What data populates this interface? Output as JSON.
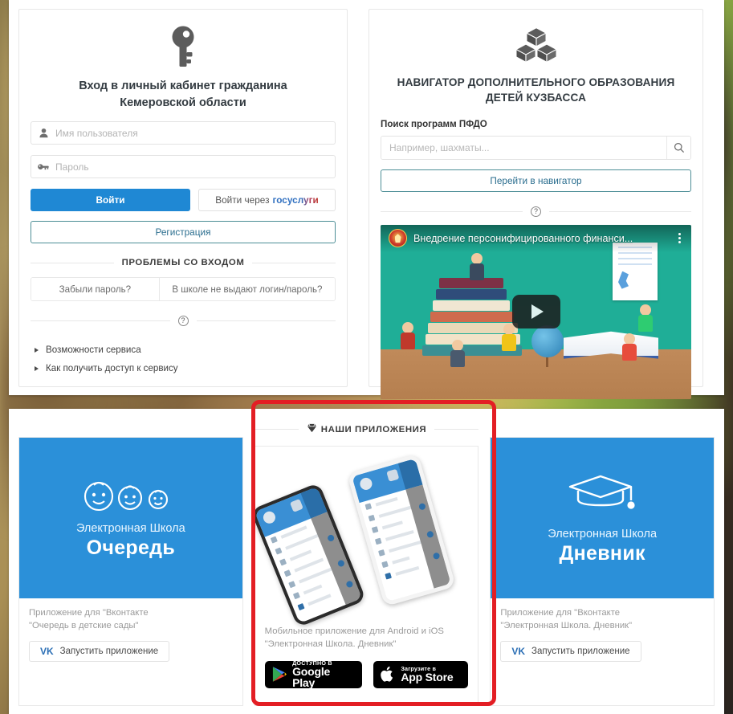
{
  "login_panel": {
    "icon": "key-icon",
    "title_line1": "Вход в личный кабинет гражданина",
    "title_line2": "Кемеровской области",
    "username": {
      "icon": "user-icon",
      "placeholder": "Имя пользователя",
      "value": ""
    },
    "password": {
      "icon": "key-small-icon",
      "placeholder": "Пароль",
      "value": ""
    },
    "login_button": "Войти",
    "gosuslugi_button_prefix": "Войти через ",
    "gosuslugi_button_brand": "госуслуги",
    "register_button": "Регистрация",
    "problems_heading": "ПРОБЛЕМЫ СО ВХОДОМ",
    "forgot_password": "Забыли пароль?",
    "no_login_from_school": "В школе не выдают логин/пароль?",
    "help_marker": "?",
    "links": [
      "Возможности сервиса",
      "Как получить доступ к сервису"
    ]
  },
  "navigator_panel": {
    "icon": "cubes-icon",
    "title_line1": "НАВИГАТОР ДОПОЛНИТЕЛЬНОГО ОБРАЗОВАНИЯ",
    "title_line2": "ДЕТЕЙ КУЗБАССА",
    "search_label": "Поиск программ ПФДО",
    "search_placeholder": "Например, шахматы...",
    "search_value": "",
    "search_icon": "magnifier-icon",
    "go_button": "Перейти в навигатор",
    "help_marker": "?",
    "video": {
      "title": "Внедрение персонифицированного финанси...",
      "channel_icon": "kemerovo-coat-of-arms",
      "play_icon": "play-icon",
      "menu_icon": "kebab-menu-icon"
    }
  },
  "apps_section": {
    "heading": "НАШИ ПРИЛОЖЕНИЯ",
    "heading_icon": "diamond-icon",
    "cards": [
      {
        "hero_icon": "baby-faces-icon",
        "hero_sub": "Электронная Школа",
        "hero_main": "Очередь",
        "desc_line1": "Приложение для \"Вконтакте",
        "desc_line2": "\"Очередь в детские сады\"",
        "button_label": "Запустить приложение",
        "button_icon": "vk-icon"
      },
      {
        "hero_icon": "phones-mockup-image",
        "desc_line1": "Мобильное приложение для Android и iOS",
        "desc_line2": "\"Электронная Школа. Дневник\"",
        "stores": [
          {
            "small": "ДОСТУПНО В",
            "big": "Google Play",
            "icon": "google-play-icon"
          },
          {
            "small": "Загрузите в",
            "big": "App Store",
            "icon": "apple-icon"
          }
        ]
      },
      {
        "hero_icon": "graduation-cap-icon",
        "hero_sub": "Электронная Школа",
        "hero_main": "Дневник",
        "desc_line1": "Приложение для \"Вконтакте",
        "desc_line2": "\"Электронная Школа. Дневник\"",
        "button_label": "Запустить приложение",
        "button_icon": "vk-icon"
      }
    ]
  },
  "annotation": {
    "highlight_color": "#e31e24"
  },
  "colors": {
    "primary_blue": "#1f88d4",
    "hero_blue": "#2b90d9",
    "teal_border": "#4d8e96",
    "video_bg": "#1fae97"
  }
}
